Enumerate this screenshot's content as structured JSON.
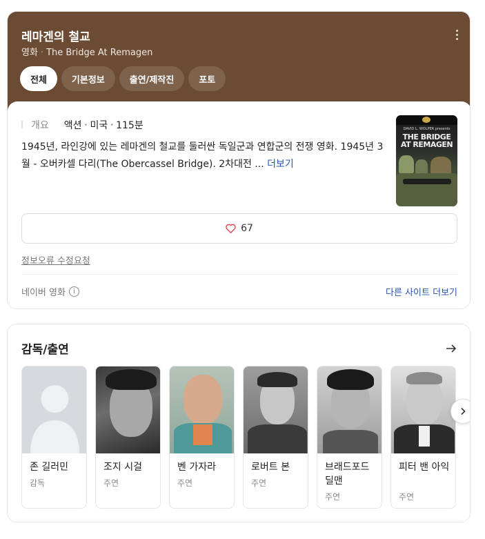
{
  "header": {
    "title": "레마겐의 철교",
    "category": "영화",
    "english_title": "The Bridge At Remagen",
    "tabs": [
      {
        "label": "전체",
        "active": true
      },
      {
        "label": "기본정보",
        "active": false
      },
      {
        "label": "출연/제작진",
        "active": false
      },
      {
        "label": "포토",
        "active": false
      }
    ]
  },
  "info": {
    "overview_label": "개요",
    "genre": "액션",
    "country": "미국",
    "runtime": "115분",
    "description": "1945년, 라인강에 있는 레마겐의 철교를 둘러싼 독일군과 연합군의 전쟁 영화. 1945년 3월 - 오버카셀 다리(The Obercassel Bridge). 2차대전 ...",
    "more_label": "더보기",
    "poster": {
      "credit": "DAVID L. WOLPER presents",
      "title": "THE BRIDGE AT REMAGEN"
    },
    "like_count": "67",
    "report_label": "정보오류 수정요청",
    "source_label": "네이버 영화",
    "other_sites_label": "다른 사이트 더보기"
  },
  "cast": {
    "section_title": "감독/출연",
    "people": [
      {
        "name": "존 길러민",
        "role": "감독",
        "photo": "placeholder"
      },
      {
        "name": "조지 시걸",
        "role": "주연",
        "photo": "bw"
      },
      {
        "name": "벤 가자라",
        "role": "주연",
        "photo": "color"
      },
      {
        "name": "로버트 본",
        "role": "주연",
        "photo": "bw"
      },
      {
        "name": "브래드포드 딜맨",
        "role": "주연",
        "photo": "bw"
      },
      {
        "name": "피터 밴 아익",
        "role": "주연",
        "photo": "bw"
      }
    ]
  },
  "colors": {
    "header_bg": "#6b4b33",
    "link": "#2956a8",
    "heart": "#e2495a"
  },
  "icons": [
    "more-vertical-icon",
    "heart-icon",
    "info-icon",
    "arrow-right-icon",
    "chevron-right-icon"
  ]
}
